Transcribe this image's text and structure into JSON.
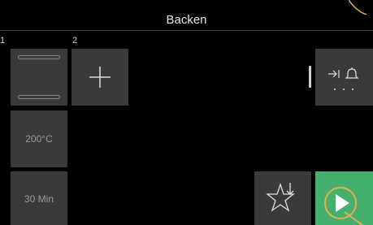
{
  "header": {
    "title": "Backen"
  },
  "steps": [
    {
      "number": "1",
      "type": "heating-mode",
      "icon": "top-bottom-heat-icon"
    },
    {
      "number": "2",
      "type": "add-step",
      "icon": "plus-icon"
    }
  ],
  "settings": {
    "temperature": "200°C",
    "duration": "30 Min"
  },
  "actions": {
    "more_icon": "timer-bell-more-icon",
    "favorite_icon": "star-download-icon",
    "start_icon": "play-icon"
  },
  "colors": {
    "background": "#000000",
    "tile": "#3a3a3a",
    "start_button": "#45b06e",
    "highlight": "#e2b24a"
  }
}
